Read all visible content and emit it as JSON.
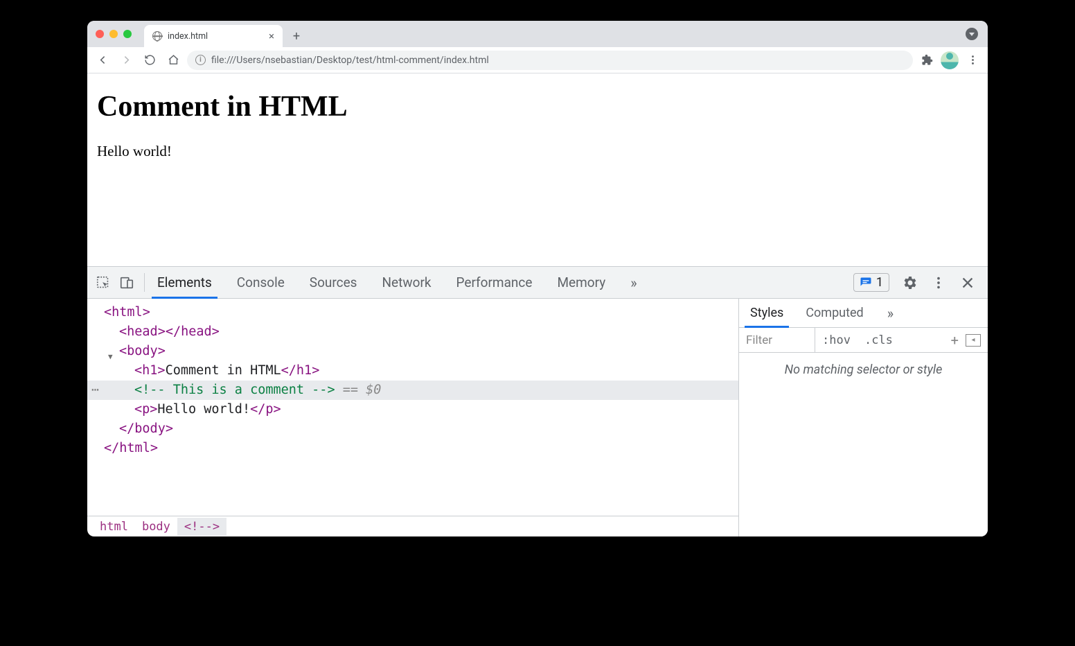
{
  "browser": {
    "tab_title": "index.html",
    "url": "file:///Users/nsebastian/Desktop/test/html-comment/index.html"
  },
  "page": {
    "heading": "Comment in HTML",
    "paragraph": "Hello world!"
  },
  "devtools": {
    "tabs": [
      "Elements",
      "Console",
      "Sources",
      "Network",
      "Performance",
      "Memory"
    ],
    "active_tab": "Elements",
    "issue_count": "1",
    "dom": {
      "l0": "<html>",
      "l1": "<head></head>",
      "l2": "<body>",
      "l3_open": "<h1>",
      "l3_text": "Comment in HTML",
      "l3_close": "</h1>",
      "l4": "<!-- This is a comment -->",
      "l4_eq": " == ",
      "l4_dollar": "$0",
      "l5_open": "<p>",
      "l5_text": "Hello world!",
      "l5_close": "</p>",
      "l6": "</body>",
      "l7": "</html>"
    },
    "crumbs": [
      "html",
      "body",
      "<!-​-​>"
    ],
    "styles": {
      "tabs": [
        "Styles",
        "Computed"
      ],
      "filter_placeholder": "Filter",
      "hov": ":hov",
      "cls": ".cls",
      "message": "No matching selector or style"
    }
  }
}
